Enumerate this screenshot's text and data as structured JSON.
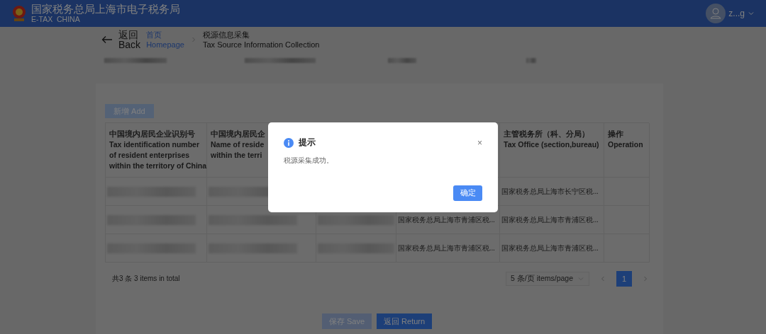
{
  "header": {
    "title": "国家税务总局上海市电子税务局",
    "subtitle": "E-TAX  CHINA",
    "user": "z...g"
  },
  "back": {
    "zh": "返回",
    "en": "Back"
  },
  "breadcrumb": [
    {
      "kind": "link",
      "zh": "首页",
      "en": "Homepage"
    },
    {
      "kind": "current",
      "zh": "税源信息采集",
      "en": "Tax Source Information Collection"
    }
  ],
  "add_button": {
    "label": "新增 Add",
    "disabled": true
  },
  "table": {
    "columns": [
      {
        "lines": [
          "中国境内居民企业识别号",
          "Tax identification number",
          "of resident enterprises",
          "within the territory of China"
        ]
      },
      {
        "lines": [
          "中国境内居民企",
          "Name of reside",
          "within the terri"
        ]
      },
      {},
      {},
      {
        "lines": [
          "主管税务所（科、分局）",
          "Tax Office (section,bureau)"
        ]
      },
      {
        "lines": [
          "操作",
          "Operation"
        ]
      }
    ],
    "rows": [
      {
        "cells": [
          {
            "kind": "redacted"
          },
          {
            "kind": "redacted"
          },
          {
            "kind": "covered"
          },
          {
            "kind": "covered"
          },
          {
            "kind": "text",
            "text": "国家税务总局上海市长宁区税..."
          },
          {
            "kind": "empty"
          }
        ]
      },
      {
        "cells": [
          {
            "kind": "redacted"
          },
          {
            "kind": "redacted"
          },
          {
            "kind": "redacted"
          },
          {
            "kind": "text",
            "text": "国家税务总局上海市青浦区税..."
          },
          {
            "kind": "text",
            "text": "国家税务总局上海市青浦区税..."
          },
          {
            "kind": "empty"
          }
        ]
      },
      {
        "cells": [
          {
            "kind": "redacted"
          },
          {
            "kind": "redacted"
          },
          {
            "kind": "redacted"
          },
          {
            "kind": "text",
            "text": "国家税务总局上海市青浦区税..."
          },
          {
            "kind": "text",
            "text": "国家税务总局上海市青浦区税..."
          },
          {
            "kind": "empty"
          }
        ]
      }
    ]
  },
  "pagination": {
    "total": "共3 条 3 items in total",
    "page_size": "5 条/页 items/page",
    "pages": [
      {
        "label": "1",
        "selected": true
      }
    ]
  },
  "footer_buttons": [
    {
      "label": "保存 Save",
      "disabled": true
    },
    {
      "label": "返回 Return",
      "disabled": false
    }
  ],
  "dialog": {
    "title": "提示",
    "close": "×",
    "message": "税源采集成功。",
    "ok": "确定"
  }
}
